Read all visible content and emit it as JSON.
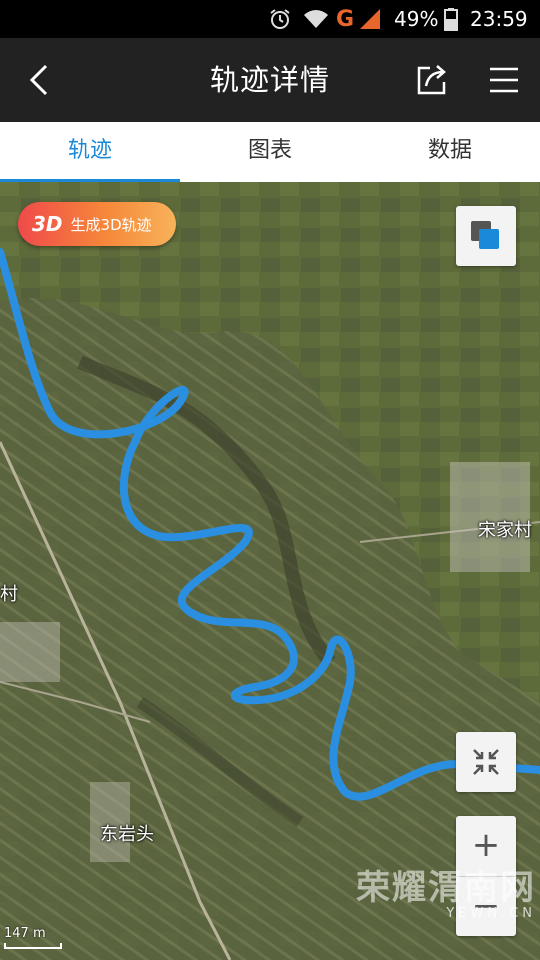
{
  "status_bar": {
    "network": "G",
    "battery": "49%",
    "time": "23:59",
    "icons": [
      "alarm-icon",
      "wifi-icon",
      "signal-icon",
      "battery-icon"
    ]
  },
  "app_bar": {
    "title": "轨迹详情",
    "icons": [
      "back-icon",
      "share-icon",
      "menu-icon"
    ]
  },
  "tabs": [
    {
      "label": "轨迹",
      "active": true
    },
    {
      "label": "图表",
      "active": false
    },
    {
      "label": "数据",
      "active": false
    }
  ],
  "map": {
    "btn_3d_big": "3D",
    "btn_3d_label": "生成3D轨迹",
    "places": [
      "宋家村",
      "村",
      "东岩头"
    ],
    "scale": "147 m",
    "zoom_in": "+",
    "zoom_out": "−",
    "watermark_big": "荣耀渭南网",
    "watermark_small": "YEWN.CN",
    "track_color": "#2a8fe0"
  }
}
